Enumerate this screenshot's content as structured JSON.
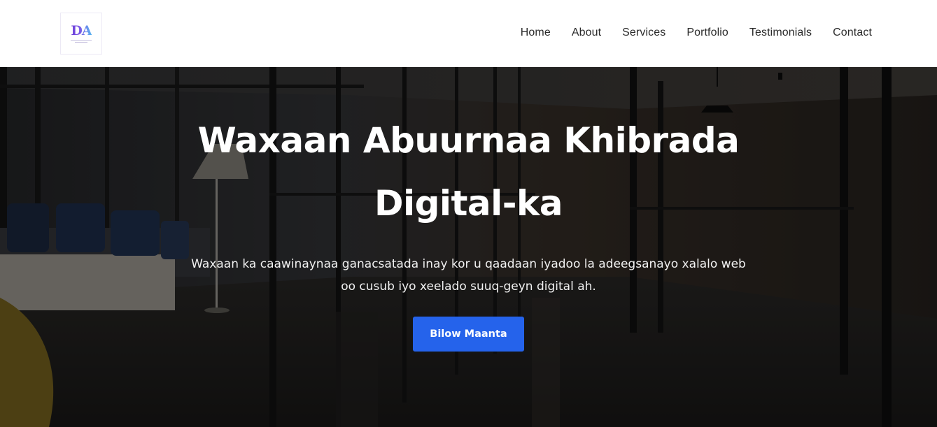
{
  "logo": {
    "mark": "DA"
  },
  "nav": {
    "items": [
      {
        "label": "Home"
      },
      {
        "label": "About"
      },
      {
        "label": "Services"
      },
      {
        "label": "Portfolio"
      },
      {
        "label": "Testimonials"
      },
      {
        "label": "Contact"
      }
    ]
  },
  "hero": {
    "title": "Waxaan Abuurnaa Khibrada Digital-ka",
    "subtitle": "Waxaan ka caawinaynaa ganacsatada inay kor u qaadaan iyadoo la adeegsanayo xalalo web oo cusub iyo xeelado suuq-geyn digital ah.",
    "cta_label": "Bilow Maanta"
  },
  "colors": {
    "accent": "#2563eb",
    "nav_text": "#2b2b2b",
    "hero_text": "#ffffff"
  }
}
